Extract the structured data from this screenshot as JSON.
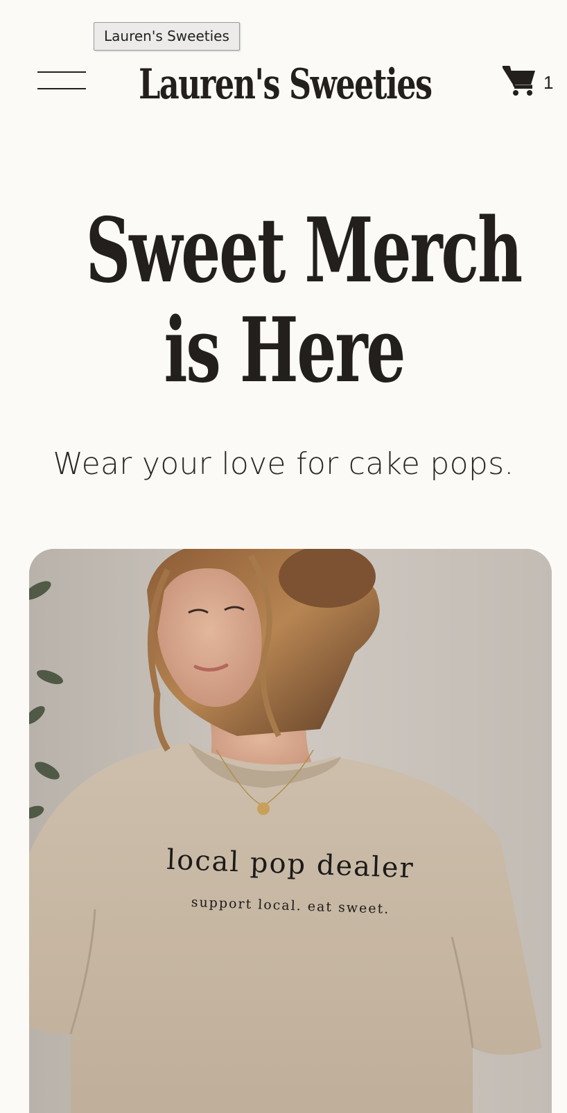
{
  "tooltip": {
    "text": "Lauren's Sweeties"
  },
  "header": {
    "site_title": "Lauren's Sweeties",
    "menu_icon": "hamburger-menu-icon",
    "cart_icon": "shopping-cart-icon",
    "cart_count": "1"
  },
  "hero": {
    "heading_line1": "Sweet Merch",
    "heading_line2": "is Here",
    "subheading": "Wear your love for cake pops.",
    "image": {
      "shirt_text": "local pop dealer",
      "shirt_tagline": "support local. eat sweet."
    }
  },
  "colors": {
    "background": "#fbfaf7",
    "text": "#231f1c",
    "shirt": "#cbbca9"
  }
}
